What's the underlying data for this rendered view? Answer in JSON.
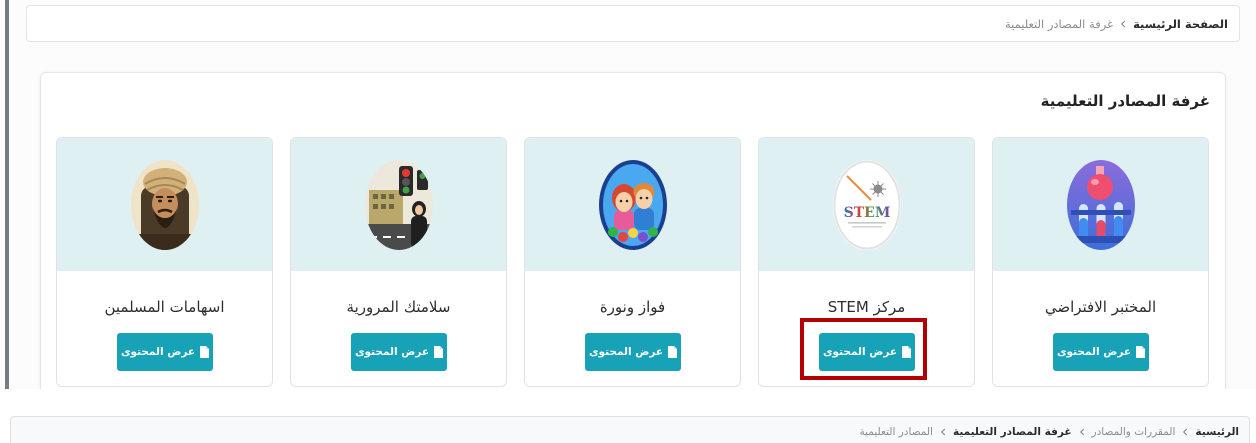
{
  "top_breadcrumb": {
    "items": [
      {
        "label": "الصفحة الرئيسية"
      },
      {
        "label": "غرفة المصادر التعليمية"
      }
    ]
  },
  "section": {
    "title": "غرفة المصادر التعليمية",
    "cards": [
      {
        "title": "المختبر الافتراضي",
        "button_label": "عرض المحتوى",
        "image_icon": "virtual-lab-image"
      },
      {
        "title": "مركز STEM",
        "button_label": "عرض المحتوى",
        "image_icon": "stem-center-logo",
        "logo_text": "STEM",
        "highlighted": true
      },
      {
        "title": "فواز ونورة",
        "button_label": "عرض المحتوى",
        "image_icon": "fawaz-noura-image"
      },
      {
        "title": "سلامتك المرورية",
        "button_label": "عرض المحتوى",
        "image_icon": "traffic-safety-image"
      },
      {
        "title": "اسهامات المسلمين",
        "button_label": "عرض المحتوى",
        "image_icon": "muslim-contributions-image"
      }
    ]
  },
  "bottom_breadcrumb": {
    "items": [
      {
        "label": "الرئيسية"
      },
      {
        "label": "المقررات والمصادر"
      },
      {
        "label": "غرفة المصادر التعليمية"
      },
      {
        "label": "المصادر التعليمية"
      }
    ]
  },
  "icons": {
    "button_icon": "file-icon",
    "separator": "chevron-left-icon"
  },
  "colors": {
    "accent": "#17a2b8",
    "card_header_bg": "#dff0f3",
    "highlight": "#b30000",
    "text_dark": "#2b2b2b",
    "text_muted": "#8c8c8c",
    "rail": "#767b85"
  }
}
